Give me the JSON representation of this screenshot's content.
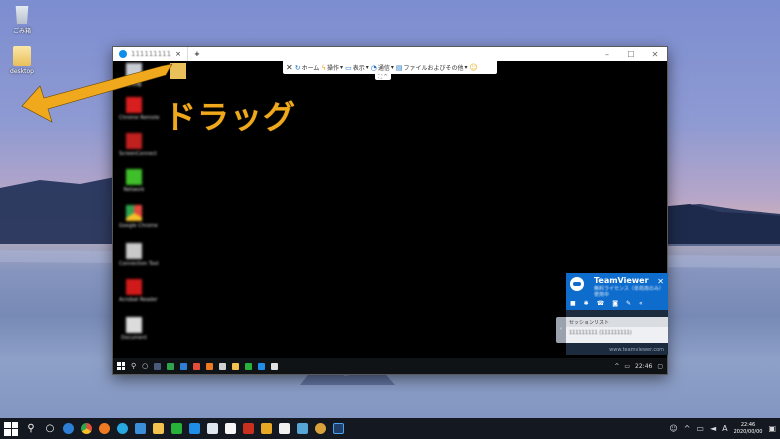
{
  "desktop": {
    "icons": [
      {
        "label": "ごみ箱",
        "icon": "recycle-bin-icon"
      },
      {
        "label": "desktop",
        "icon": "folder-icon"
      }
    ]
  },
  "teamviewer_window": {
    "tab_title": "111111111",
    "tab_close": "×",
    "new_tab": "+",
    "minimize": "–",
    "maximize": "☐",
    "close": "✕",
    "toolbar": {
      "close_label": "✕",
      "home_label": "ホーム",
      "actions_label": "操作",
      "view_label": "表示",
      "communicate_label": "通信",
      "files_label": "ファイルおよびその他",
      "emoji": "☺"
    }
  },
  "remote_desktop": {
    "icons": [
      {
        "label": "ごみ箱",
        "color": "#c8ccd4"
      },
      {
        "label": "Chrome Remote",
        "color": "#d81e1e"
      },
      {
        "label": "ScreenConnect",
        "color": "#c0201e"
      },
      {
        "label": "Network",
        "color": "#3fbf2a"
      },
      {
        "label": "Google Chrome",
        "color": "#e5483c"
      },
      {
        "label": "Connection Tool",
        "color": "#c9c9c9"
      },
      {
        "label": "Acrobat Reader",
        "color": "#d01a1a"
      },
      {
        "label": "Document",
        "color": "#dcdcdc"
      }
    ],
    "taskbar_time": "22:46"
  },
  "teamviewer_panel": {
    "brand": "TeamViewer",
    "subtitle": "無料ライセンス（非商用のみ）使用中",
    "close": "✕",
    "session_header": "セッションリスト",
    "session_row": "111111111 (111111111)",
    "footer": "www.teamviewer.com",
    "side_tab": "‹"
  },
  "annotation": {
    "label": "ドラッグ",
    "color": "#f0a81c"
  },
  "taskbar": {
    "search_symbol": "⚲",
    "task_view_symbol": "○",
    "time": "22:46",
    "date": "2020/00/00",
    "lang": "A",
    "apps": [
      {
        "icon": "edge-icon",
        "color": "#2d7fd6"
      },
      {
        "icon": "chrome-icon",
        "color": "#e44d3a"
      },
      {
        "icon": "firefox-icon",
        "color": "#f07a21"
      },
      {
        "icon": "skype-icon",
        "color": "#27a8e0"
      },
      {
        "icon": "store-icon",
        "color": "#3b8fd8"
      },
      {
        "icon": "explorer-icon",
        "color": "#f2c14e"
      },
      {
        "icon": "line-icon",
        "color": "#27b33a"
      },
      {
        "icon": "teamviewer-icon",
        "color": "#1e8ee8"
      },
      {
        "icon": "notepad-icon",
        "color": "#dfe6ee"
      },
      {
        "icon": "file-icon",
        "color": "#f6f6f6"
      },
      {
        "icon": "filezilla-icon",
        "color": "#c9301e"
      },
      {
        "icon": "app-icon",
        "color": "#e8a825"
      },
      {
        "icon": "paint-icon",
        "color": "#f0f0f0"
      },
      {
        "icon": "photos-icon",
        "color": "#57a5d6"
      },
      {
        "icon": "settings-icon",
        "color": "#d9a23a"
      },
      {
        "icon": "photoshop-icon",
        "color": "#1f3f6a"
      }
    ]
  }
}
